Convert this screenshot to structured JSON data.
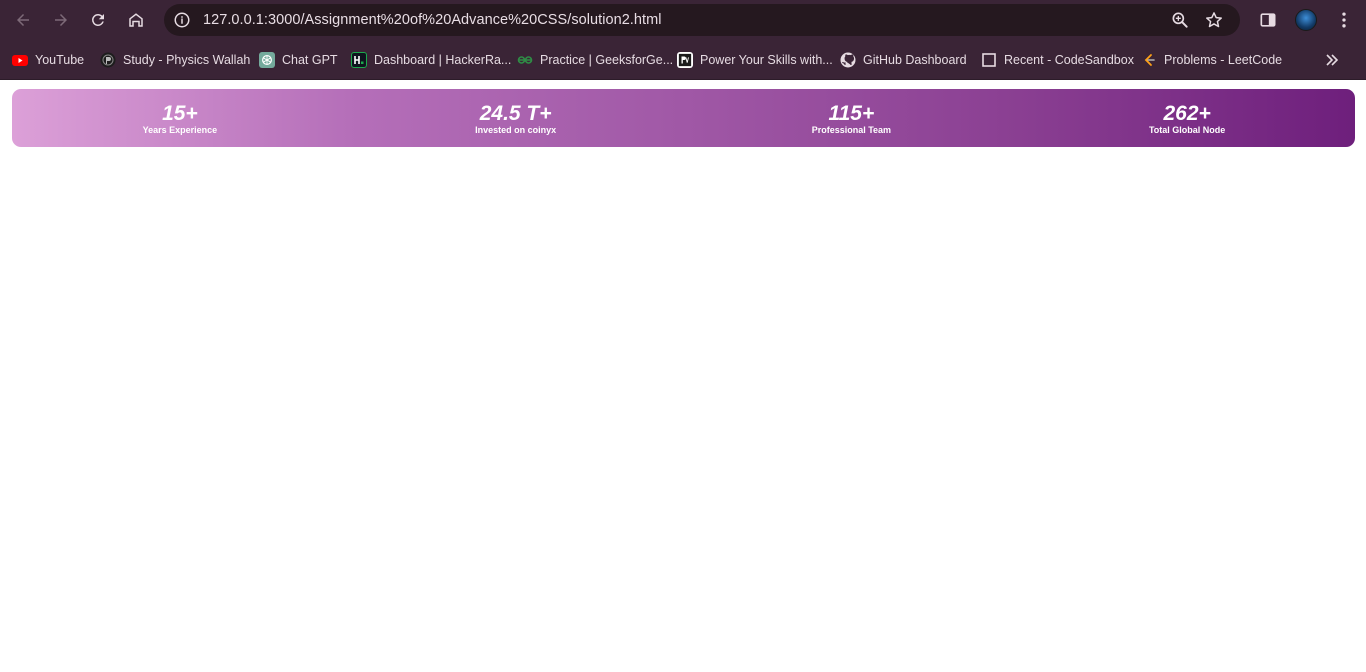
{
  "browser": {
    "url": "127.0.0.1:3000/Assignment%20of%20Advance%20CSS/solution2.html",
    "icons": {
      "back": "arrow-left-icon",
      "forward": "arrow-right-icon",
      "reload": "reload-icon",
      "home": "home-icon",
      "info": "info-icon",
      "zoom": "magnifier-icon",
      "bookmark": "star-icon",
      "sidepanel": "side-panel-icon",
      "menu": "kebab-menu-icon"
    },
    "colors": {
      "toolbar": "#3a2436",
      "omnibox": "#25181f",
      "text": "#e8dde4"
    }
  },
  "bookmarks": [
    {
      "label": "YouTube",
      "icon": "youtube-icon"
    },
    {
      "label": "Study - Physics Wallah",
      "icon": "pw-icon"
    },
    {
      "label": "Chat GPT",
      "icon": "chatgpt-icon"
    },
    {
      "label": "Dashboard | HackerRa...",
      "icon": "hackerrank-icon"
    },
    {
      "label": "Practice | GeeksforGe...",
      "icon": "gfg-icon"
    },
    {
      "label": "Power Your Skills with...",
      "icon": "pw-skills-icon"
    },
    {
      "label": "GitHub Dashboard",
      "icon": "github-icon"
    },
    {
      "label": "Recent - CodeSandbox",
      "icon": "codesandbox-icon"
    },
    {
      "label": "Problems - LeetCode",
      "icon": "leetcode-icon"
    }
  ],
  "stats": {
    "colors": {
      "gradient_start": "#dca0d8",
      "gradient_end": "#6e1f7c",
      "text": "#ffffff"
    },
    "items": [
      {
        "value": "15+",
        "label": "Years Experience"
      },
      {
        "value": "24.5 T+",
        "label": "Invested on coinyx"
      },
      {
        "value": "115+",
        "label": "Professional Team"
      },
      {
        "value": "262+",
        "label": "Total Global Node"
      }
    ]
  }
}
